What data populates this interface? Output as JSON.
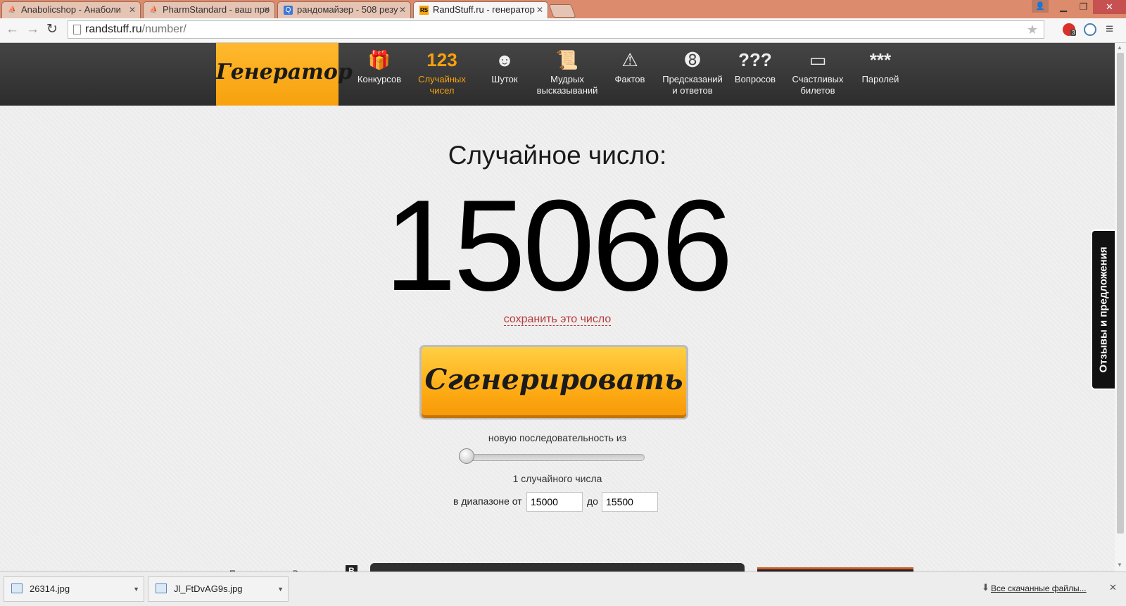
{
  "browser": {
    "tabs": [
      {
        "title": "Anabolicshop - Анаболи",
        "active": false
      },
      {
        "title": "PharmStandard - ваш про",
        "active": false
      },
      {
        "title": "рандомайзер - 508 резу",
        "active": false
      },
      {
        "title": "RandStuff.ru - генератор",
        "active": true
      }
    ],
    "url_host": "randstuff.ru",
    "url_path": "/number/",
    "extension_badge": "3"
  },
  "site": {
    "logo": "Генератор",
    "nav": [
      {
        "icon": "gift-icon",
        "glyph": "🎁",
        "label": "Конкурсов",
        "active": false
      },
      {
        "icon": "numbers-icon",
        "glyph": "123",
        "label": "Случайных чисел",
        "active": true
      },
      {
        "icon": "smiley-icon",
        "glyph": "☻",
        "label": "Шуток",
        "active": false
      },
      {
        "icon": "scroll-icon",
        "glyph": "📜",
        "label": "Мудрых высказываний",
        "active": false
      },
      {
        "icon": "warning-icon",
        "glyph": "◆",
        "label": "Фактов",
        "active": false
      },
      {
        "icon": "eight-ball-icon",
        "glyph": "➑",
        "label": "Предсказаний и ответов",
        "active": false
      },
      {
        "icon": "question-marks-icon",
        "glyph": "???",
        "label": "Вопросов",
        "active": false
      },
      {
        "icon": "ticket-icon",
        "glyph": "▭",
        "label": "Счастливых билетов",
        "active": false
      },
      {
        "icon": "asterisks-icon",
        "glyph": "***",
        "label": "Паролей",
        "active": false
      }
    ]
  },
  "main": {
    "heading": "Случайное число:",
    "number": "15066",
    "save_link": "сохранить это число",
    "generate_button": "Сгенерировать",
    "sequence_label": "новую последовательность из",
    "count_label": "1 случайного числа",
    "slider_level": 0,
    "range_from_label": "в диапазоне от",
    "range_from_value": "15000",
    "range_to_label": "до",
    "range_to_value": "15500",
    "vk_app_label": "Приложение во Вконтакте",
    "vk_badge": "В",
    "feedback_tab": "Отзывы и предложения"
  },
  "downloads": {
    "items": [
      "26314.jpg",
      "Jl_FtDvAG9s.jpg"
    ],
    "show_all": "Все скачанные файлы..."
  },
  "colors": {
    "accent": "#f7a10d",
    "header_bg": "#333333",
    "link": "#b83b3b",
    "titlebar": "#dd8b6d"
  }
}
